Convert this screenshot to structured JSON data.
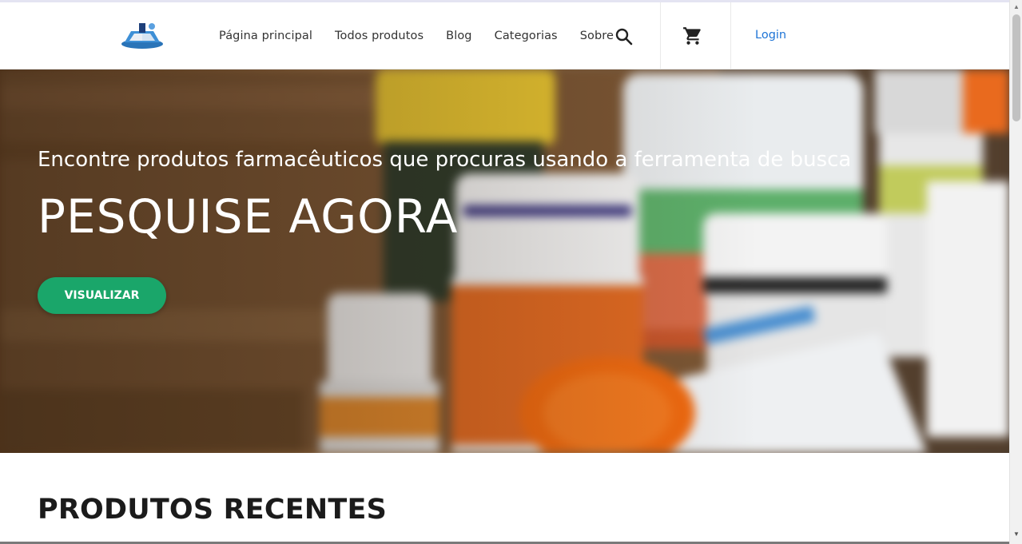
{
  "header": {
    "nav": [
      {
        "label": "Página principal"
      },
      {
        "label": "Todos produtos"
      },
      {
        "label": "Blog"
      },
      {
        "label": "Categorias"
      },
      {
        "label": "Sobre"
      }
    ],
    "login_label": "Login",
    "icons": {
      "search": "search-icon",
      "cart": "cart-icon",
      "logo": "logo"
    }
  },
  "hero": {
    "subtitle": "Encontre produtos farmacêuticos que procuras usando a ferramenta de busca",
    "title": "PESQUISE AGORA",
    "button_label": "VISUALIZAR"
  },
  "sections": {
    "recent_title": "PRODUTOS RECENTES"
  },
  "colors": {
    "accent_green": "#1aa66a",
    "login_blue": "#1e74d6",
    "text_dark": "#1b1b1b"
  },
  "scrollbar": {
    "up": "▲",
    "down": "▼"
  }
}
